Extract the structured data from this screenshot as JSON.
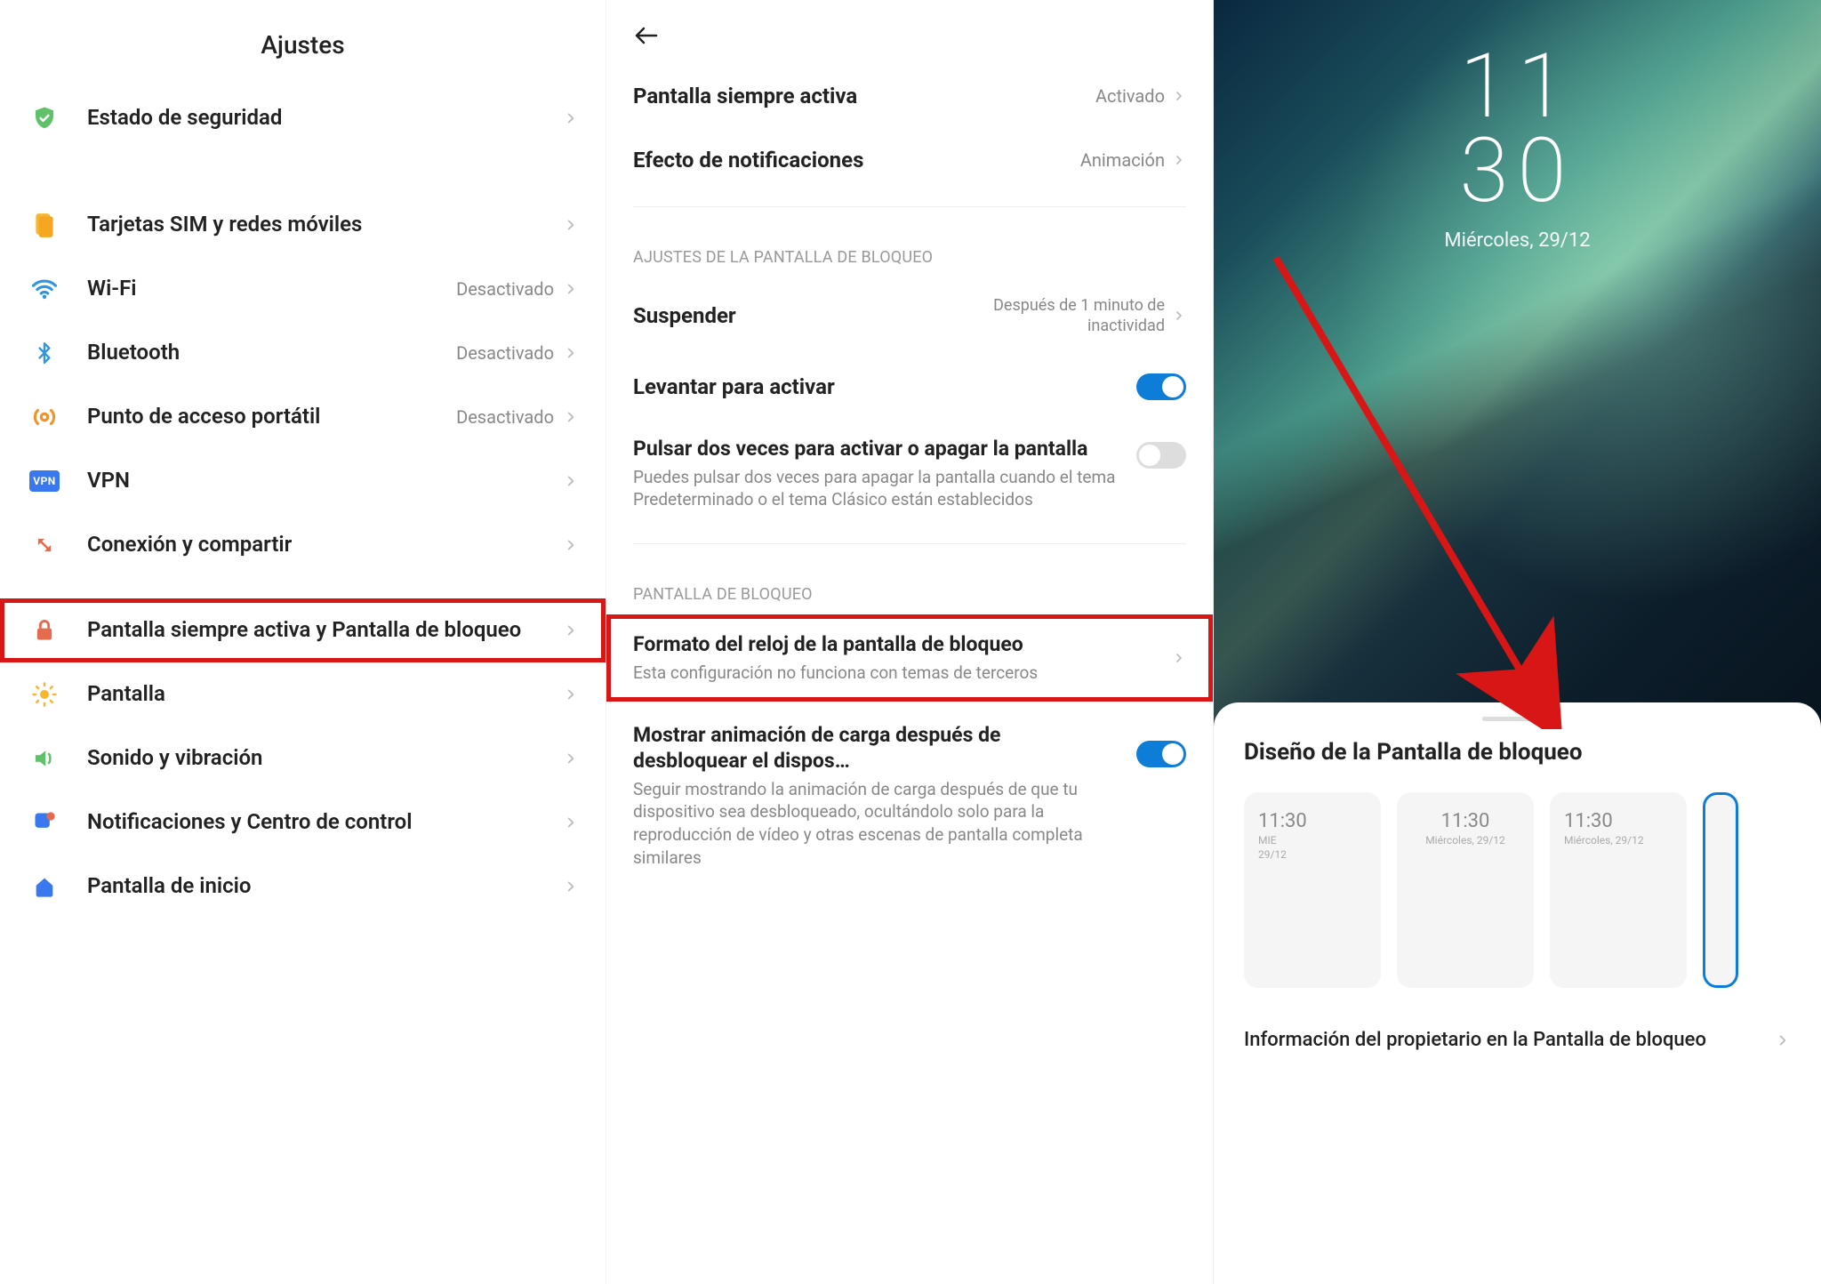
{
  "panel1": {
    "title": "Ajustes",
    "items": [
      {
        "label": "Estado de seguridad",
        "status": ""
      },
      {
        "label": "Tarjetas SIM y redes móviles",
        "status": ""
      },
      {
        "label": "Wi-Fi",
        "status": "Desactivado"
      },
      {
        "label": "Bluetooth",
        "status": "Desactivado"
      },
      {
        "label": "Punto de acceso portátil",
        "status": "Desactivado"
      },
      {
        "label": "VPN",
        "status": ""
      },
      {
        "label": "Conexión y compartir",
        "status": ""
      },
      {
        "label": "Pantalla siempre activa y Pantalla de bloqueo",
        "status": "",
        "highlight": true
      },
      {
        "label": "Pantalla",
        "status": ""
      },
      {
        "label": "Sonido y vibración",
        "status": ""
      },
      {
        "label": "Notificaciones y Centro de control",
        "status": ""
      },
      {
        "label": "Pantalla de inicio",
        "status": ""
      }
    ]
  },
  "panel2": {
    "top": [
      {
        "title": "Pantalla siempre activa",
        "value": "Activado"
      },
      {
        "title": "Efecto de notificaciones",
        "value": "Animación"
      }
    ],
    "section1": "AJUSTES DE LA PANTALLA DE BLOQUEO",
    "suspend": {
      "title": "Suspender",
      "value": "Después de 1 minuto de inactividad"
    },
    "raise": {
      "title": "Levantar para activar"
    },
    "tap": {
      "title": "Pulsar dos veces para activar o apagar la pantalla",
      "sub": "Puedes pulsar dos veces para apagar la pantalla cuando el tema Predeterminado o el tema Clásico están establecidos"
    },
    "section2": "PANTALLA DE BLOQUEO",
    "clockformat": {
      "title": "Formato del reloj de la pantalla de bloqueo",
      "sub": "Esta configuración no funciona con temas de terceros"
    },
    "charging": {
      "title": "Mostrar animación de carga después de desbloquear el dispos…",
      "sub": "Seguir mostrando la animación de carga después de que tu dispositivo sea desbloqueado, ocultándolo solo para la reproducción de vídeo y otras escenas de pantalla completa similares"
    }
  },
  "panel3": {
    "clock_hour": "11",
    "clock_min": "30",
    "date": "Miércoles, 29/12",
    "bs_title": "Diseño de la Pantalla de bloqueo",
    "options": [
      {
        "time": "11:30",
        "line1": "MIE",
        "line2": "29/12",
        "align": "left"
      },
      {
        "time": "11:30",
        "line1": "Miércoles, 29/12",
        "line2": "",
        "align": "center"
      },
      {
        "time": "11:30",
        "line1": "Miércoles, 29/12",
        "line2": "",
        "align": "left"
      },
      {
        "time": "",
        "line1": "",
        "line2": "",
        "selected": true
      }
    ],
    "owner_info": "Información del propietario en la Pantalla de bloqueo"
  }
}
